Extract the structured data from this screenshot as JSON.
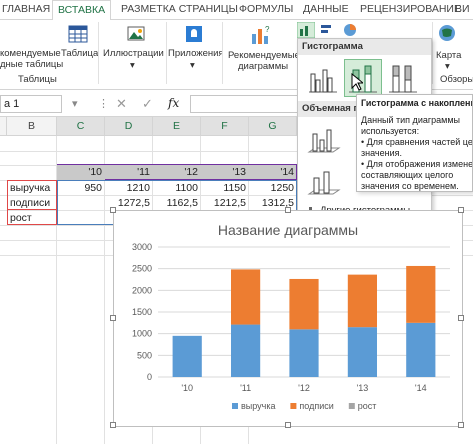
{
  "ribbon": {
    "tabs": [
      "ГЛАВНАЯ",
      "ВСТАВКА",
      "РАЗМЕТКА СТРАНИЦЫ",
      "ФОРМУЛЫ",
      "ДАННЫЕ",
      "РЕЦЕНЗИРОВАНИЕ",
      "ВИ"
    ],
    "active_tab": "ВСТАВКА",
    "recommended_tables_line1": "комендуемые",
    "recommended_tables_line2": "дные таблицы",
    "table_label": "Таблица",
    "group_tables": "Таблицы",
    "illustrations": "Иллюстрации",
    "apps": "Приложения",
    "recommended_charts_line1": "Рекомендуемые",
    "recommended_charts_line2": "диаграммы",
    "map": "Карта",
    "reviews": "Обзоры"
  },
  "formula_bar": {
    "name_box": "а 1",
    "cancel": "✕",
    "enter": "✓",
    "fx": "fx"
  },
  "columns": [
    "B",
    "C",
    "D",
    "E",
    "F",
    "G"
  ],
  "years": [
    "'10",
    "'11",
    "'12",
    "'13",
    "'14"
  ],
  "rows": [
    {
      "label": "выручка",
      "values": [
        "950",
        "1210",
        "1100",
        "1150",
        "1250"
      ]
    },
    {
      "label": "подписи",
      "values": [
        "",
        "1272,5",
        "1162,5",
        "1212,5",
        "1312,5"
      ]
    },
    {
      "label": "рост",
      "values": [
        "",
        "",
        "",
        "",
        ""
      ]
    }
  ],
  "dropdown": {
    "header": "Гистограмма",
    "header_3d": "Объемная г",
    "more": "Другие гистограммы..."
  },
  "tooltip": {
    "title": "Гистограмма с накоплени",
    "lines": [
      "Данный тип диаграммы",
      "используется:",
      "• Для сравнения частей цел",
      "значения.",
      "• Для отображения изменен",
      "составляющих целого",
      "значения со временем."
    ]
  },
  "chart_data": {
    "type": "bar",
    "stacked": true,
    "title": "Название диаграммы",
    "categories": [
      "'10",
      "'11",
      "'12",
      "'13",
      "'14"
    ],
    "series": [
      {
        "name": "выручка",
        "values": [
          950,
          1210,
          1100,
          1150,
          1250
        ],
        "color": "#5b9bd5"
      },
      {
        "name": "подписи",
        "values": [
          0,
          1272.5,
          1162.5,
          1212.5,
          1312.5
        ],
        "color": "#ed7d31"
      },
      {
        "name": "рост",
        "values": [
          0,
          0,
          0,
          0,
          0
        ],
        "color": "#a5a5a5"
      }
    ],
    "ylim": [
      0,
      3000
    ],
    "yticks": [
      "0",
      "500",
      "1000",
      "1500",
      "2000",
      "2500",
      "3000"
    ],
    "grid": true,
    "legend": "bottom"
  }
}
